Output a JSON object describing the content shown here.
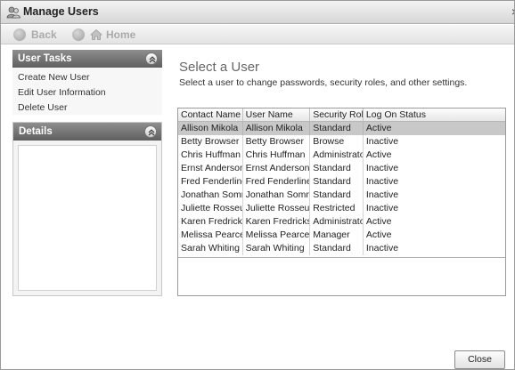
{
  "window": {
    "title": "Manage Users",
    "close_glyph": "×"
  },
  "nav": {
    "back_label": "Back",
    "home_label": "Home"
  },
  "sidebar": {
    "tasks_title": "User Tasks",
    "tasks": [
      {
        "label": "Create New User"
      },
      {
        "label": "Edit User Information"
      },
      {
        "label": "Delete User"
      }
    ],
    "details_title": "Details"
  },
  "main": {
    "heading": "Select a User",
    "subtitle": "Select a user to change passwords, security roles, and other settings."
  },
  "table": {
    "columns": [
      "Contact Name",
      "User Name",
      "Security Role",
      "Log On Status"
    ],
    "rows": [
      {
        "contact": "Allison Mikola",
        "user": "Allison Mikola",
        "role": "Standard",
        "status": "Active",
        "selected": true
      },
      {
        "contact": "Betty Browser",
        "user": "Betty Browser",
        "role": "Browse",
        "status": "Inactive"
      },
      {
        "contact": "Chris Huffman",
        "user": "Chris Huffman",
        "role": "Administrator",
        "status": "Active"
      },
      {
        "contact": "Ernst Anderson",
        "user": "Ernst Anderson",
        "role": "Standard",
        "status": "Inactive"
      },
      {
        "contact": "Fred Fenderline",
        "user": "Fred Fenderline",
        "role": "Standard",
        "status": "Inactive"
      },
      {
        "contact": "Jonathan Somme",
        "user": "Jonathan Somme",
        "role": "Standard",
        "status": "Inactive"
      },
      {
        "contact": "Juliette Rosseux",
        "user": "Juliette Rosseux",
        "role": "Restricted",
        "status": "Inactive"
      },
      {
        "contact": "Karen Fredricks",
        "user": "Karen Fredricks",
        "role": "Administrator",
        "status": "Active"
      },
      {
        "contact": "Melissa Pearce",
        "user": "Melissa Pearce",
        "role": "Manager",
        "status": "Active"
      },
      {
        "contact": "Sarah Whiting",
        "user": "Sarah Whiting",
        "role": "Standard",
        "status": "Inactive"
      }
    ]
  },
  "footer": {
    "close_label": "Close"
  },
  "icons": {
    "app": "users-icon",
    "back": "back-arrow-icon",
    "home": "home-icon",
    "collapse": "chevron-up-double-icon"
  },
  "colors": {
    "panel_header": "#6f6f6f",
    "selected_row": "#c8c8c8",
    "heading": "#666666"
  }
}
